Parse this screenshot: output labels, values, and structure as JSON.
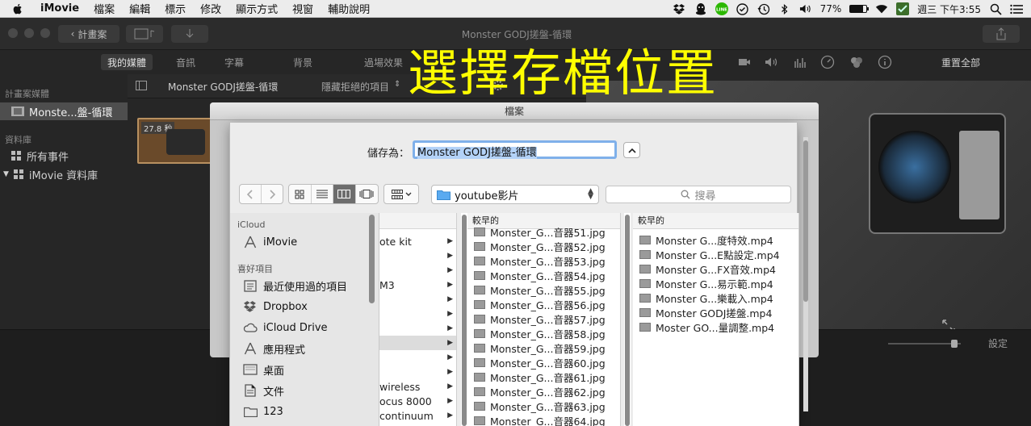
{
  "menubar": {
    "app": "iMovie",
    "items": [
      "檔案",
      "編輯",
      "標示",
      "修改",
      "顯示方式",
      "視窗",
      "輔助說明"
    ],
    "battery": "77%",
    "clock": "週三 下午3:55"
  },
  "imovie": {
    "back_button": "計畫案",
    "window_title": "Monster GODJ搓盤-循環",
    "tabs": [
      "我的媒體",
      "音訊",
      "字幕",
      "背景",
      "過場效果"
    ],
    "reset_all": "重置全部",
    "settings": "設定",
    "sidebar": {
      "projects_header": "計畫案媒體",
      "project_item": "Monste...盤-循環",
      "library_header": "資料庫",
      "all_events": "所有事件",
      "library": "iMovie 資料庫"
    },
    "browser_title": "Monster GODJ搓盤-循環",
    "hide_rejected": "隱藏拒絕的項目",
    "clip_duration": "27.8 秒"
  },
  "overlay_title": "選擇存檔位置",
  "dialog": {
    "window_title": "檔案",
    "save_as_label": "儲存為：",
    "save_as_value": "Monster GODJ搓盤-循環",
    "path_folder": "youtube影片",
    "search_placeholder": "搜尋",
    "sidebar": {
      "icloud_header": "iCloud",
      "icloud_items": [
        "iMovie"
      ],
      "favorites_header": "喜好項目",
      "favorites": [
        "最近使用過的項目",
        "Dropbox",
        "iCloud Drive",
        "應用程式",
        "桌面",
        "文件",
        "123"
      ]
    },
    "col1_rows": [
      "ote kit",
      "",
      "",
      "M3",
      "",
      "",
      "",
      "",
      "",
      "",
      "wireless",
      "ocus 8000",
      "continuum"
    ],
    "col2_header": "較早的",
    "col2_rows": [
      "Monster_G...音器51.jpg",
      "Monster_G...音器52.jpg",
      "Monster_G...音器53.jpg",
      "Monster_G...音器54.jpg",
      "Monster_G...音器55.jpg",
      "Monster_G...音器56.jpg",
      "Monster_G...音器57.jpg",
      "Monster_G...音器58.jpg",
      "Monster_G...音器59.jpg",
      "Monster_G...音器60.jpg",
      "Monster_G...音器61.jpg",
      "Monster_G...音器62.jpg",
      "Monster_G...音器63.jpg",
      "Monster_G...音器64.jpg"
    ],
    "col3_header": "較早的",
    "col3_rows": [
      "Monster G...度特效.mp4",
      "Monster G...E點設定.mp4",
      "Monster G...FX音效.mp4",
      "Monster G...易示範.mp4",
      "Monster G...樂載入.mp4",
      "Monster GODJ搓盤.mp4",
      "Moster GO...量調整.mp4"
    ]
  },
  "colors": {
    "overlay": "#ffff00",
    "selection": "#b3d2f8"
  }
}
